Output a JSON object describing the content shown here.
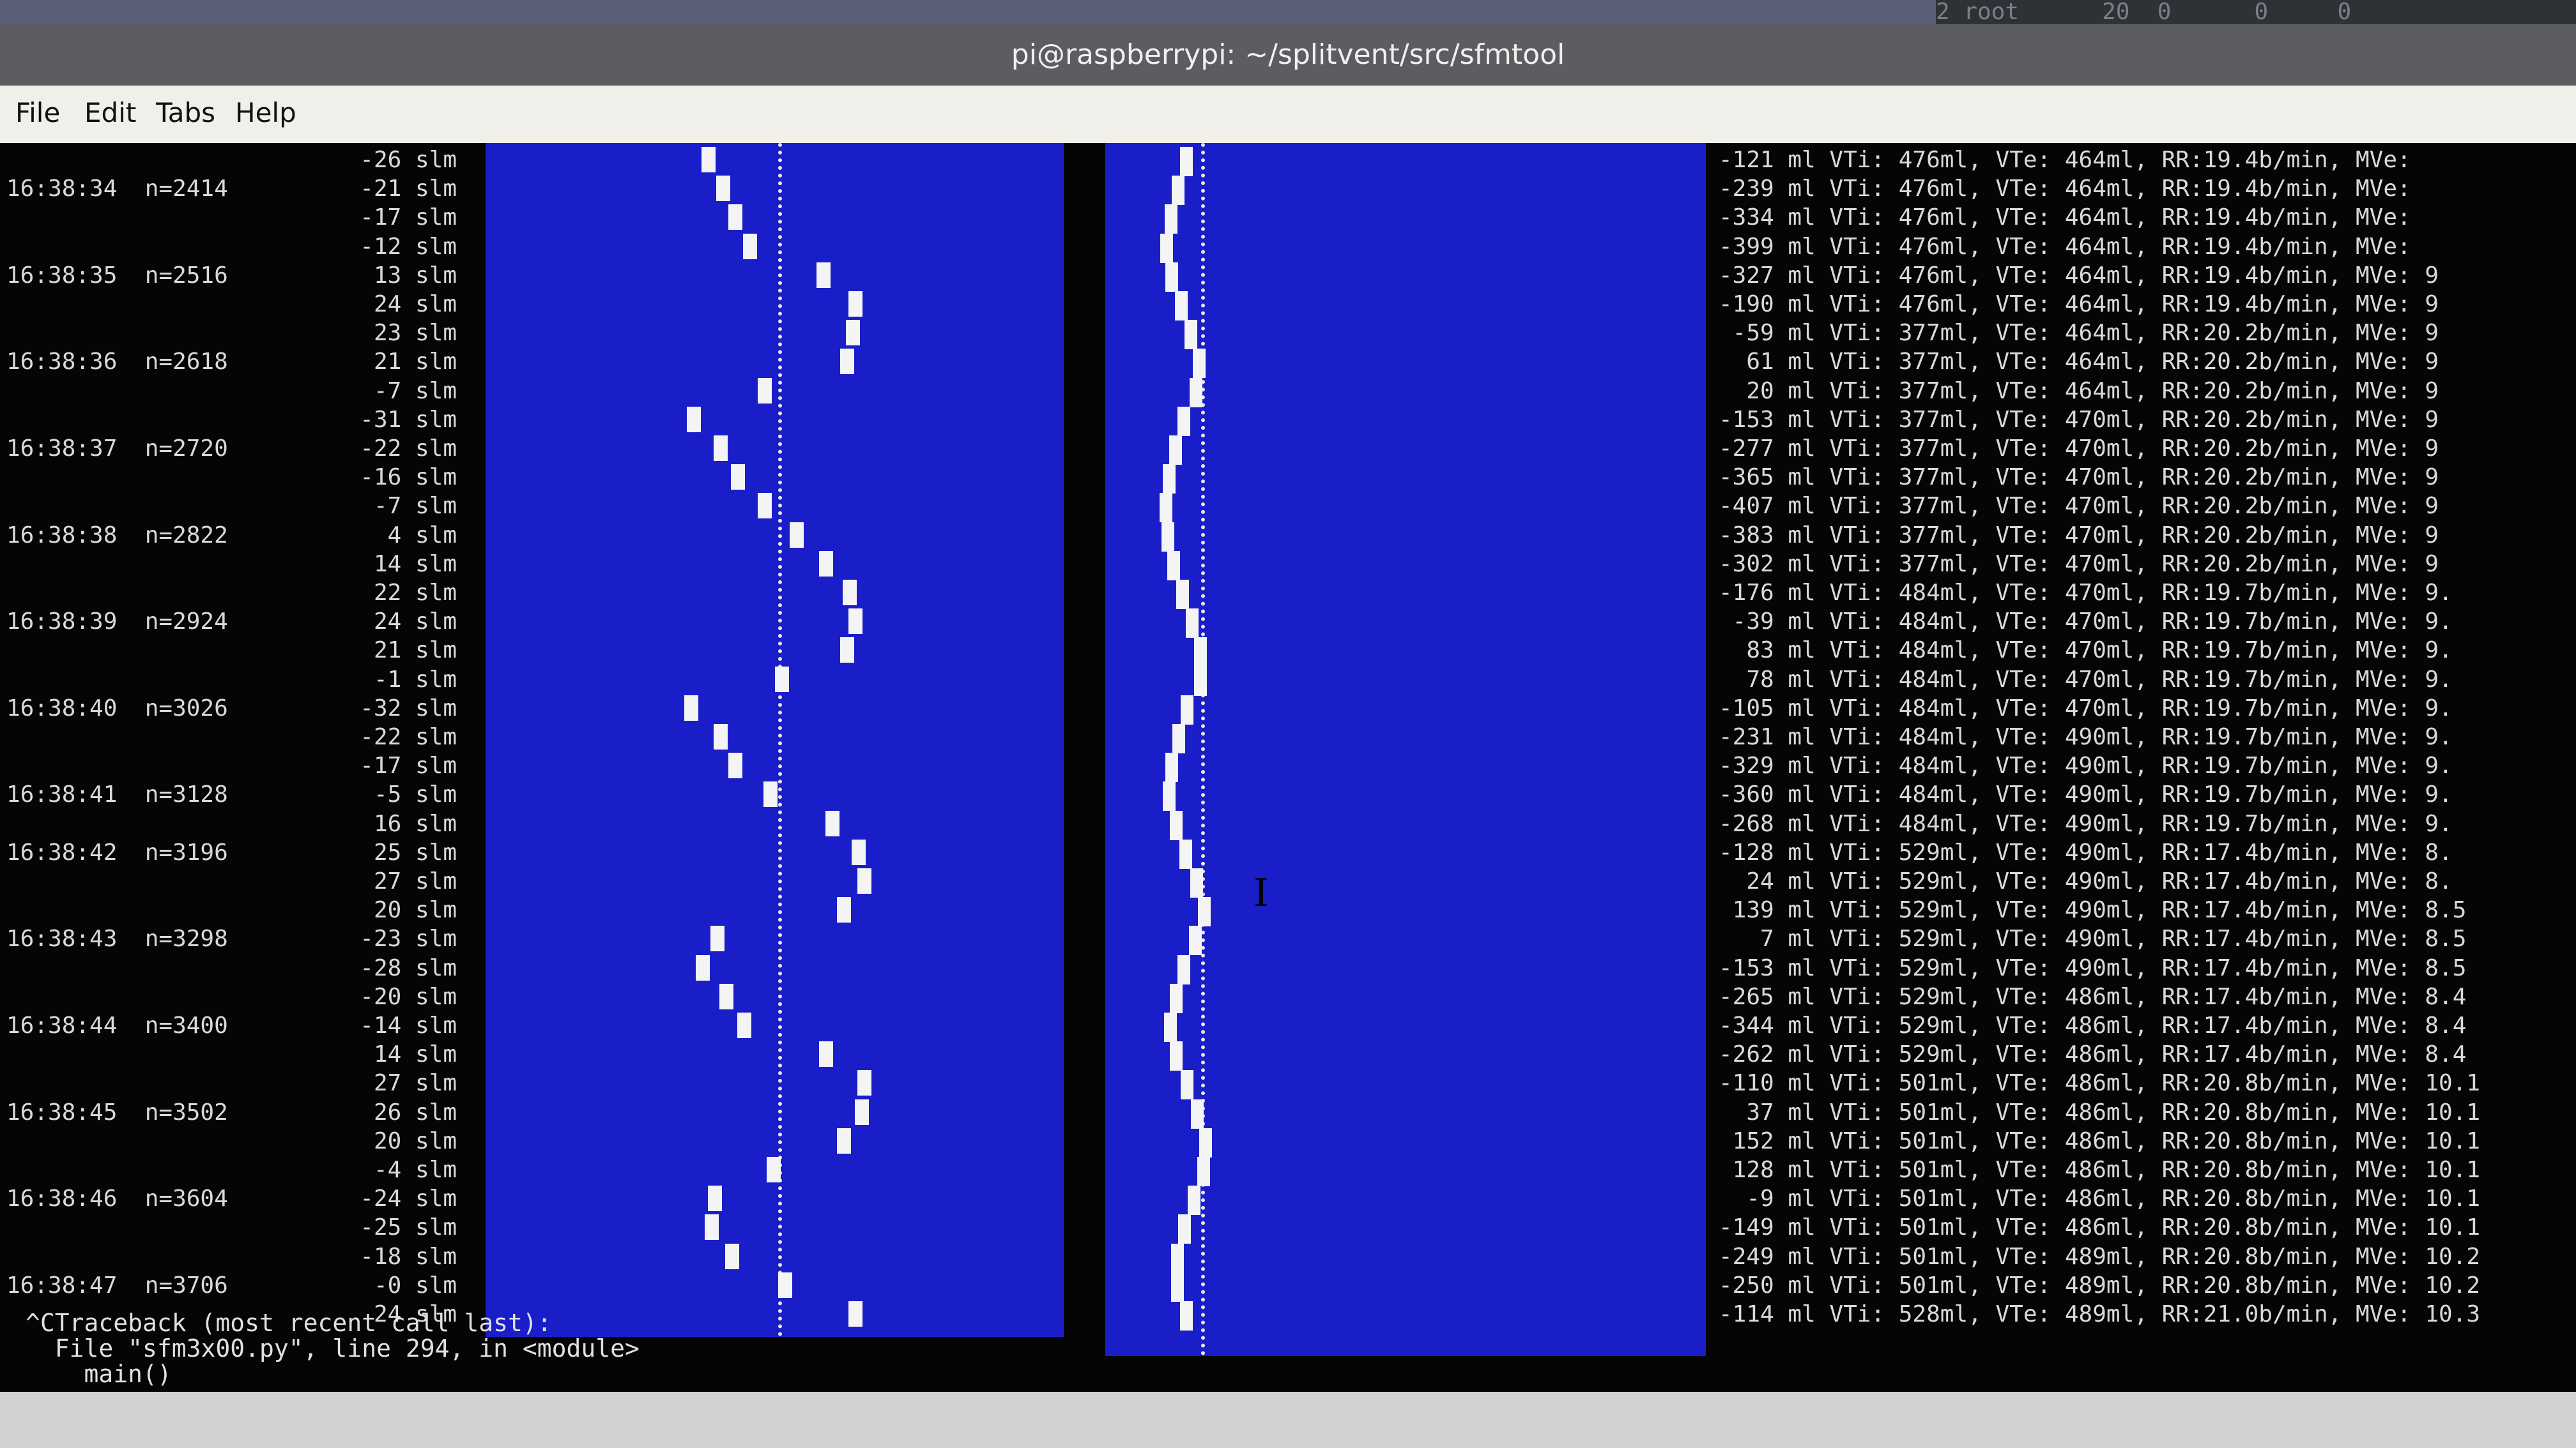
{
  "taskbar": {
    "text": "2 root      20  0      0     0"
  },
  "window": {
    "title": "pi@raspberrypi: ~/splitvent/src/sfmtool"
  },
  "menu": {
    "file": "File",
    "edit": "Edit",
    "tabs": "Tabs",
    "help": "Help"
  },
  "terminal": {
    "timestamps": [
      "16:38:34  n=2414",
      "16:38:35  n=2516",
      "16:38:36  n=2618",
      "16:38:37  n=2720",
      "16:38:38  n=2822",
      "16:38:39  n=2924",
      "16:38:40  n=3026",
      "16:38:41  n=3128",
      "16:38:42  n=3196",
      "16:38:43  n=3298",
      "16:38:44  n=3400",
      "16:38:45  n=3502",
      "16:38:46  n=3604",
      "16:38:47  n=3706"
    ],
    "slm": [
      "-26 slm",
      "-21 slm",
      "-17 slm",
      "-12 slm",
      "13 slm",
      "24 slm",
      "23 slm",
      "21 slm",
      "-7 slm",
      "-31 slm",
      "-22 slm",
      "-16 slm",
      "-7 slm",
      "4 slm",
      "14 slm",
      "22 slm",
      "24 slm",
      "21 slm",
      "-1 slm",
      "-32 slm",
      "-22 slm",
      "-17 slm",
      "-5 slm",
      "16 slm",
      "25 slm",
      "27 slm",
      "20 slm",
      "-23 slm",
      "-28 slm",
      "-20 slm",
      "-14 slm",
      "14 slm",
      "27 slm",
      "26 slm",
      "20 slm",
      "-4 slm",
      "-24 slm",
      "-25 slm",
      "-18 slm",
      "-0 slm",
      "24 slm"
    ],
    "volumes": [
      "-121 ml VTi: 476ml, VTe: 464ml, RR:19.4b/min, MVe:",
      "-239 ml VTi: 476ml, VTe: 464ml, RR:19.4b/min, MVe:",
      "-334 ml VTi: 476ml, VTe: 464ml, RR:19.4b/min, MVe:",
      "-399 ml VTi: 476ml, VTe: 464ml, RR:19.4b/min, MVe:",
      "-327 ml VTi: 476ml, VTe: 464ml, RR:19.4b/min, MVe: 9",
      "-190 ml VTi: 476ml, VTe: 464ml, RR:19.4b/min, MVe: 9",
      " -59 ml VTi: 377ml, VTe: 464ml, RR:20.2b/min, MVe: 9",
      "  61 ml VTi: 377ml, VTe: 464ml, RR:20.2b/min, MVe: 9",
      "  20 ml VTi: 377ml, VTe: 464ml, RR:20.2b/min, MVe: 9",
      "-153 ml VTi: 377ml, VTe: 470ml, RR:20.2b/min, MVe: 9",
      "-277 ml VTi: 377ml, VTe: 470ml, RR:20.2b/min, MVe: 9",
      "-365 ml VTi: 377ml, VTe: 470ml, RR:20.2b/min, MVe: 9",
      "-407 ml VTi: 377ml, VTe: 470ml, RR:20.2b/min, MVe: 9",
      "-383 ml VTi: 377ml, VTe: 470ml, RR:20.2b/min, MVe: 9",
      "-302 ml VTi: 377ml, VTe: 470ml, RR:20.2b/min, MVe: 9",
      "-176 ml VTi: 484ml, VTe: 470ml, RR:19.7b/min, MVe: 9.",
      " -39 ml VTi: 484ml, VTe: 470ml, RR:19.7b/min, MVe: 9.",
      "  83 ml VTi: 484ml, VTe: 470ml, RR:19.7b/min, MVe: 9.",
      "  78 ml VTi: 484ml, VTe: 470ml, RR:19.7b/min, MVe: 9.",
      "-105 ml VTi: 484ml, VTe: 470ml, RR:19.7b/min, MVe: 9.",
      "-231 ml VTi: 484ml, VTe: 490ml, RR:19.7b/min, MVe: 9.",
      "-329 ml VTi: 484ml, VTe: 490ml, RR:19.7b/min, MVe: 9.",
      "-360 ml VTi: 484ml, VTe: 490ml, RR:19.7b/min, MVe: 9.",
      "-268 ml VTi: 484ml, VTe: 490ml, RR:19.7b/min, MVe: 9.",
      "-128 ml VTi: 529ml, VTe: 490ml, RR:17.4b/min, MVe: 8.",
      "  24 ml VTi: 529ml, VTe: 490ml, RR:17.4b/min, MVe: 8.",
      " 139 ml VTi: 529ml, VTe: 490ml, RR:17.4b/min, MVe: 8.5",
      "   7 ml VTi: 529ml, VTe: 490ml, RR:17.4b/min, MVe: 8.5",
      "-153 ml VTi: 529ml, VTe: 490ml, RR:17.4b/min, MVe: 8.5",
      "-265 ml VTi: 529ml, VTe: 486ml, RR:17.4b/min, MVe: 8.4",
      "-344 ml VTi: 529ml, VTe: 486ml, RR:17.4b/min, MVe: 8.4",
      "-262 ml VTi: 529ml, VTe: 486ml, RR:17.4b/min, MVe: 8.4",
      "-110 ml VTi: 501ml, VTe: 486ml, RR:20.8b/min, MVe: 10.1",
      "  37 ml VTi: 501ml, VTe: 486ml, RR:20.8b/min, MVe: 10.1",
      " 152 ml VTi: 501ml, VTe: 486ml, RR:20.8b/min, MVe: 10.1",
      " 128 ml VTi: 501ml, VTe: 486ml, RR:20.8b/min, MVe: 10.1",
      "  -9 ml VTi: 501ml, VTe: 486ml, RR:20.8b/min, MVe: 10.1",
      "-149 ml VTi: 501ml, VTe: 486ml, RR:20.8b/min, MVe: 10.1",
      "-249 ml VTi: 501ml, VTe: 489ml, RR:20.8b/min, MVe: 10.2",
      "-250 ml VTi: 501ml, VTe: 489ml, RR:20.8b/min, MVe: 10.2",
      "-114 ml VTi: 528ml, VTe: 489ml, RR:21.0b/min, MVe: 10.3"
    ],
    "traceback": [
      "^CTraceback (most recent call last):",
      "  File \"sfm3x00.py\", line 294, in <module>",
      "    main()"
    ]
  },
  "icons": {
    "cursor": "text-cursor-icon"
  },
  "colors": {
    "plot_background": "#1a1ec8",
    "trace": "#f4f4f4",
    "terminal_bg": "#050505"
  }
}
